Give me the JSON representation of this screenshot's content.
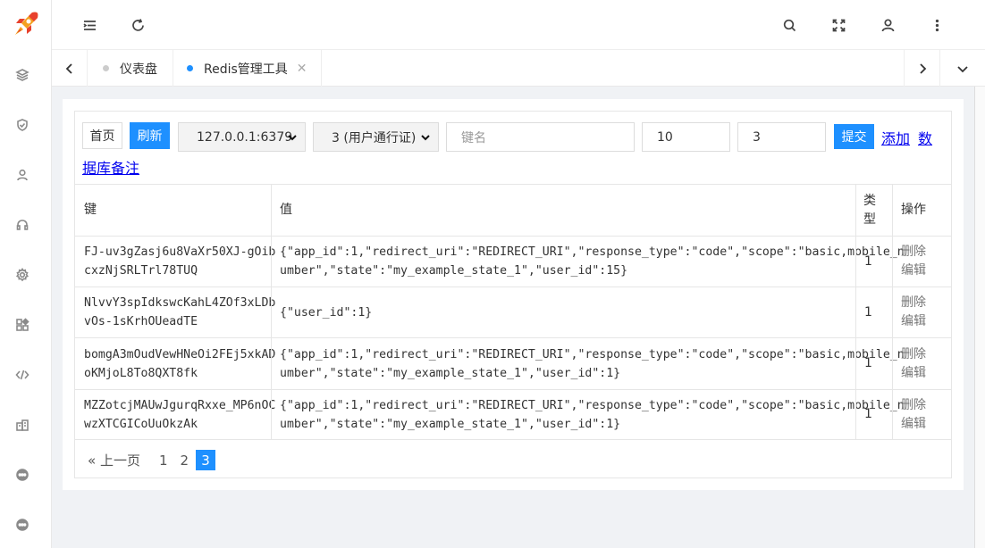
{
  "header": {
    "icons": [
      "menu-fold-icon",
      "refresh-icon",
      "search-icon",
      "fullscreen-icon",
      "user-icon",
      "more-vertical-icon"
    ]
  },
  "sidebar": {
    "icons": [
      "layers-icon",
      "shield-icon",
      "user-icon",
      "headset-icon",
      "gear-icon",
      "apps-icon",
      "code-icon",
      "building-icon",
      "chat-icon",
      "chat-icon"
    ]
  },
  "tabs": [
    {
      "label": "仪表盘",
      "active": false,
      "dot_color": "#cccccc"
    },
    {
      "label": "Redis管理工具",
      "active": true,
      "dot_color": "#1e90ff"
    }
  ],
  "toolbar": {
    "home_label": "首页",
    "refresh_label": "刷新",
    "server_select": "127.0.0.1:6379",
    "db_select": "3 (用户通行证)",
    "key_placeholder": "键名",
    "count_value": "10",
    "db_value": "3",
    "submit_label": "提交",
    "add_label": "添加",
    "db_note_label_1": "数",
    "db_note_label_2": "据库备注"
  },
  "table": {
    "headers": {
      "key": "键",
      "value": "值",
      "type_1": "类",
      "type_2": "型",
      "ops": "操作"
    },
    "rows": [
      {
        "key_1": "FJ-uv3gZasj6u8VaXr50XJ-gOib",
        "key_2": "cxzNjSRLTrl78TUQ",
        "val_1": "{\"app_id\":1,\"redirect_uri\":\"REDIRECT_URI\",\"response_type\":\"code\",\"scope\":\"basic,mobile_n",
        "val_2": "umber\",\"state\":\"my_example_state_1\",\"user_id\":15}",
        "type": "1",
        "del": "删除",
        "edit": "编辑"
      },
      {
        "key_1": "NlvvY3spIdkswcKahL4ZOf3xLDb",
        "key_2": "vOs-1sKrhOUeadTE",
        "val_1": "{\"user_id\":1}",
        "val_2": "",
        "type": "1",
        "del": "删除",
        "edit": "编辑"
      },
      {
        "key_1": "bomgA3mOudVewHNeOi2FEj5xkAD",
        "key_2": "oKMjoL8To8QXT8fk",
        "val_1": "{\"app_id\":1,\"redirect_uri\":\"REDIRECT_URI\",\"response_type\":\"code\",\"scope\":\"basic,mobile_n",
        "val_2": "umber\",\"state\":\"my_example_state_1\",\"user_id\":1}",
        "type": "1",
        "del": "删除",
        "edit": "编辑"
      },
      {
        "key_1": "MZZotcjMAUwJgurqRxxe_MP6nOC",
        "key_2": "wzXTCGICoUuOkzAk",
        "val_1": "{\"app_id\":1,\"redirect_uri\":\"REDIRECT_URI\",\"response_type\":\"code\",\"scope\":\"basic,mobile_n",
        "val_2": "umber\",\"state\":\"my_example_state_1\",\"user_id\":1}",
        "type": "1",
        "del": "删除",
        "edit": "编辑"
      }
    ]
  },
  "pagination": {
    "prev_label": "« 上一页",
    "pages": [
      "1",
      "2",
      "3"
    ],
    "active_page": "3"
  },
  "colors": {
    "accent": "#1e90ff",
    "link": "#0000ee"
  }
}
